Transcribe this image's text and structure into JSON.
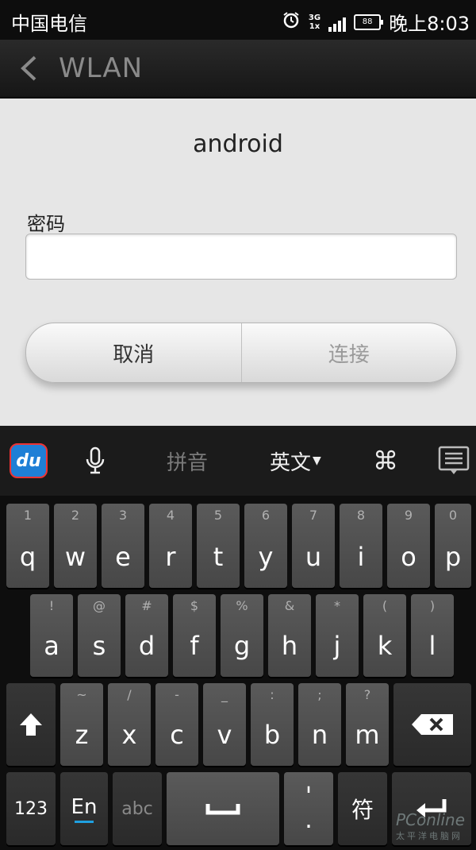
{
  "status": {
    "carrier": "中国电信",
    "network_top": "3G",
    "network_bottom": "1x",
    "battery": "88",
    "time": "晚上8:03"
  },
  "titlebar": {
    "title": "WLAN"
  },
  "dialog": {
    "ssid": "android",
    "password_label": "密码",
    "password_value": "",
    "cancel_label": "取消",
    "connect_label": "连接"
  },
  "ime_toolbar": {
    "logo": "du",
    "pinyin_label": "拼音",
    "lang_label": "英文"
  },
  "keyboard": {
    "row1": [
      {
        "main": "q",
        "sub": "1"
      },
      {
        "main": "w",
        "sub": "2"
      },
      {
        "main": "e",
        "sub": "3"
      },
      {
        "main": "r",
        "sub": "4"
      },
      {
        "main": "t",
        "sub": "5"
      },
      {
        "main": "y",
        "sub": "6"
      },
      {
        "main": "u",
        "sub": "7"
      },
      {
        "main": "i",
        "sub": "8"
      },
      {
        "main": "o",
        "sub": "9"
      },
      {
        "main": "p",
        "sub": "0"
      }
    ],
    "row2": [
      {
        "main": "a",
        "sub": "!"
      },
      {
        "main": "s",
        "sub": "@"
      },
      {
        "main": "d",
        "sub": "#"
      },
      {
        "main": "f",
        "sub": "$"
      },
      {
        "main": "g",
        "sub": "%"
      },
      {
        "main": "h",
        "sub": "&"
      },
      {
        "main": "j",
        "sub": "*"
      },
      {
        "main": "k",
        "sub": "("
      },
      {
        "main": "l",
        "sub": ")"
      }
    ],
    "row3": [
      {
        "main": "z",
        "sub": "~"
      },
      {
        "main": "x",
        "sub": "/"
      },
      {
        "main": "c",
        "sub": "-"
      },
      {
        "main": "v",
        "sub": "_"
      },
      {
        "main": "b",
        "sub": ":"
      },
      {
        "main": "n",
        "sub": ";"
      },
      {
        "main": "m",
        "sub": "?"
      }
    ],
    "num_label": "123",
    "en_label": "En",
    "abc_label": "abc",
    "punct_top": "'",
    "punct_bottom": ".",
    "symbol_label": "符"
  },
  "watermark": {
    "brand": "PConline",
    "sub": "太平洋电脑网"
  },
  "colors": {
    "status_bg": "#0d0d0d",
    "dialog_bg": "#e6e6e6",
    "keyboard_bg": "#0e0e0e",
    "key_bg": "#4f4f4f",
    "logo_blue": "#1f7fd6"
  },
  "icons": [
    "alarm-icon",
    "signal-icon",
    "battery-icon",
    "back-icon",
    "du-logo-icon",
    "microphone-icon",
    "command-icon",
    "keyboard-hide-icon",
    "shift-icon",
    "backspace-icon",
    "space-icon",
    "enter-icon"
  ]
}
